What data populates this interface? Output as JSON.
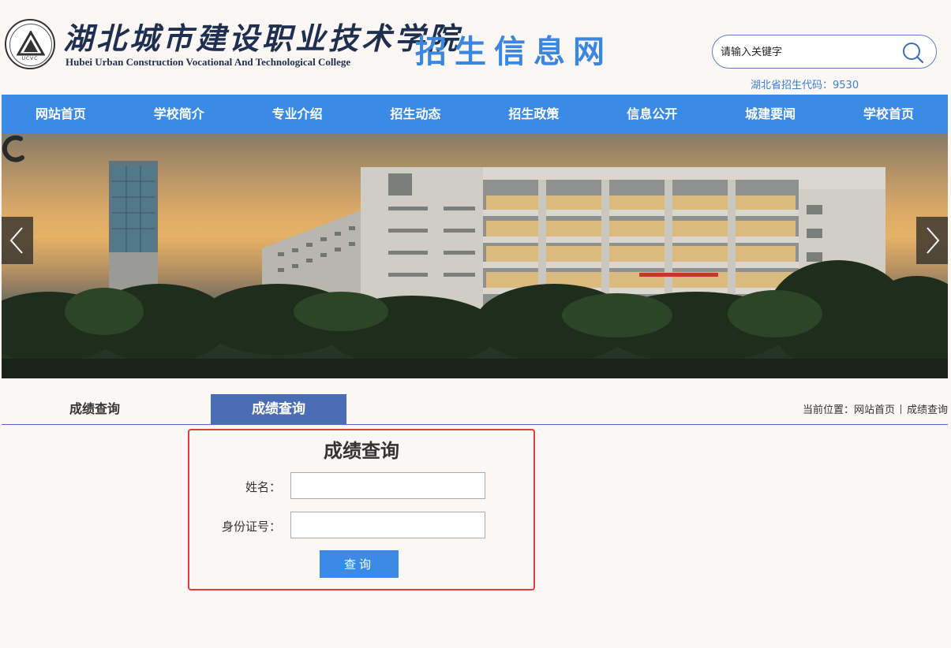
{
  "header": {
    "seal_text": "UCVC",
    "school_name_cn": "湖北城市建设职业技术学院",
    "school_name_en": "Hubei Urban Construction Vocational And Technological College",
    "site_title": "招生信息网",
    "search_placeholder": "请输入关键字",
    "enroll_code": "湖北省招生代码：9530"
  },
  "nav": {
    "items": [
      "网站首页",
      "学校简介",
      "专业介绍",
      "招生动态",
      "招生政策",
      "信息公开",
      "城建要闻",
      "学校首页"
    ]
  },
  "content": {
    "side_title": "成绩查询",
    "tab_title": "成绩查询",
    "breadcrumb_prefix": "当前位置：",
    "breadcrumb_home": "网站首页",
    "breadcrumb_current": "成绩查询"
  },
  "form": {
    "title": "成绩查询",
    "name_label": "姓名：",
    "id_label": "身份证号：",
    "submit_label": "查询",
    "name_value": "",
    "id_value": ""
  },
  "colors": {
    "nav_bg": "#3a8ae6",
    "tab_bg": "#4b6db5",
    "highlight_border": "#e53b3b",
    "page_bg": "#fbf7f4"
  }
}
